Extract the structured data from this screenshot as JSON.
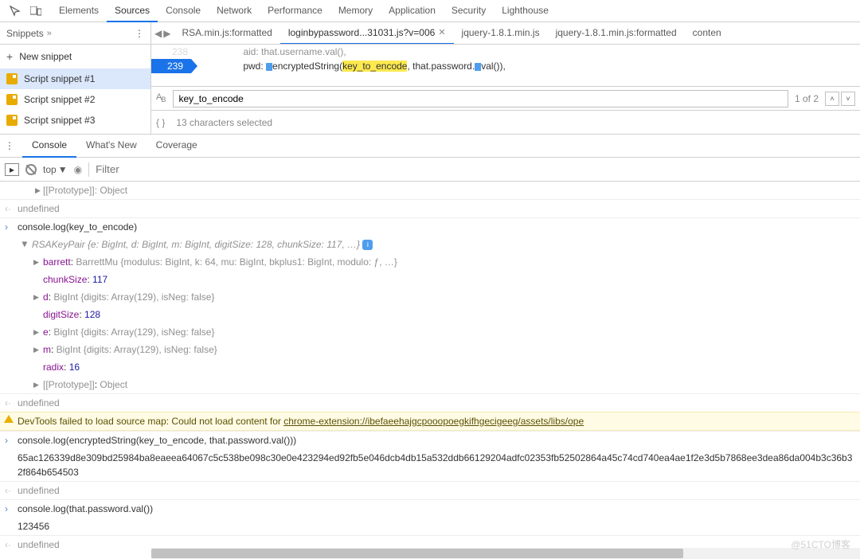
{
  "topbar": {
    "panels": [
      "Elements",
      "Sources",
      "Console",
      "Network",
      "Performance",
      "Memory",
      "Application",
      "Security",
      "Lighthouse"
    ],
    "selected": 1
  },
  "snippets": {
    "title": "Snippets",
    "new_label": "New snippet",
    "items": [
      "Script snippet #1",
      "Script snippet #2",
      "Script snippet #3"
    ],
    "selected": 0
  },
  "tabs": {
    "items": [
      "RSA.min.js:formatted",
      "loginbypassword...31031.js?v=006",
      "jquery-1.8.1.min.js",
      "jquery-1.8.1.min.js:formatted",
      "conten"
    ],
    "selected": 1
  },
  "code": {
    "line_prev": "238",
    "line_cur": "239",
    "prefix": "                pwd: ",
    "fn": "encryptedString(",
    "highlighted": "key_to_encode",
    "suffix": ", that.password.",
    "suffix2": "val()),",
    "faded": "                aid: that.username.val(),"
  },
  "find": {
    "value": "key_to_encode",
    "count": "1 of 2"
  },
  "selected_info": "13 characters selected",
  "drawer": {
    "tabs": [
      "Console",
      "What's New",
      "Coverage"
    ],
    "selected": 0
  },
  "console_toolbar": {
    "context": "top",
    "filter_placeholder": "Filter"
  },
  "out": {
    "proto_initial": "[[Prototype]]: Object",
    "undef": "undefined",
    "cmd1": "console.log(key_to_encode)",
    "rsa_head": "RSAKeyPair {e: BigInt, d: BigInt, m: BigInt, digitSize: 128, chunkSize: 117, …}",
    "barrett_key": "barrett",
    "barrett_val": "BarrettMu {modulus: BigInt, k: 64, mu: BigInt, bkplus1: BigInt, modulo: ƒ, …}",
    "chunk_key": "chunkSize",
    "chunk_val": "117",
    "d_key": "d",
    "d_val": "BigInt {digits: Array(129), isNeg: false}",
    "digit_key": "digitSize",
    "digit_val": "128",
    "e_key": "e",
    "e_val": "BigInt {digits: Array(129), isNeg: false}",
    "m_key": "m",
    "m_val": "BigInt {digits: Array(129), isNeg: false}",
    "radix_key": "radix",
    "radix_val": "16",
    "proto_key": "[[Prototype]]",
    "proto_val": "Object",
    "warn": "DevTools failed to load source map: Could not load content for ",
    "warn_link": "chrome-extension://ibefaeehajgcpooopoegkifhgecigeeg/assets/libs/ope",
    "cmd2": "console.log(encryptedString(key_to_encode, that.password.val()))",
    "hash": "65ac126339d8e309bd25984ba8eaeea64067c5c538be098c30e0e423294ed92fb5e046dcb4db15a532ddb66129204adfc02353fb52502864a45c74cd740ea4ae1f2e3d5b7868ee3dea86da004b3c36b32f864b654503",
    "cmd3": "console.log(that.password.val())",
    "res3": "123456"
  },
  "watermark": "@51CTO博客"
}
